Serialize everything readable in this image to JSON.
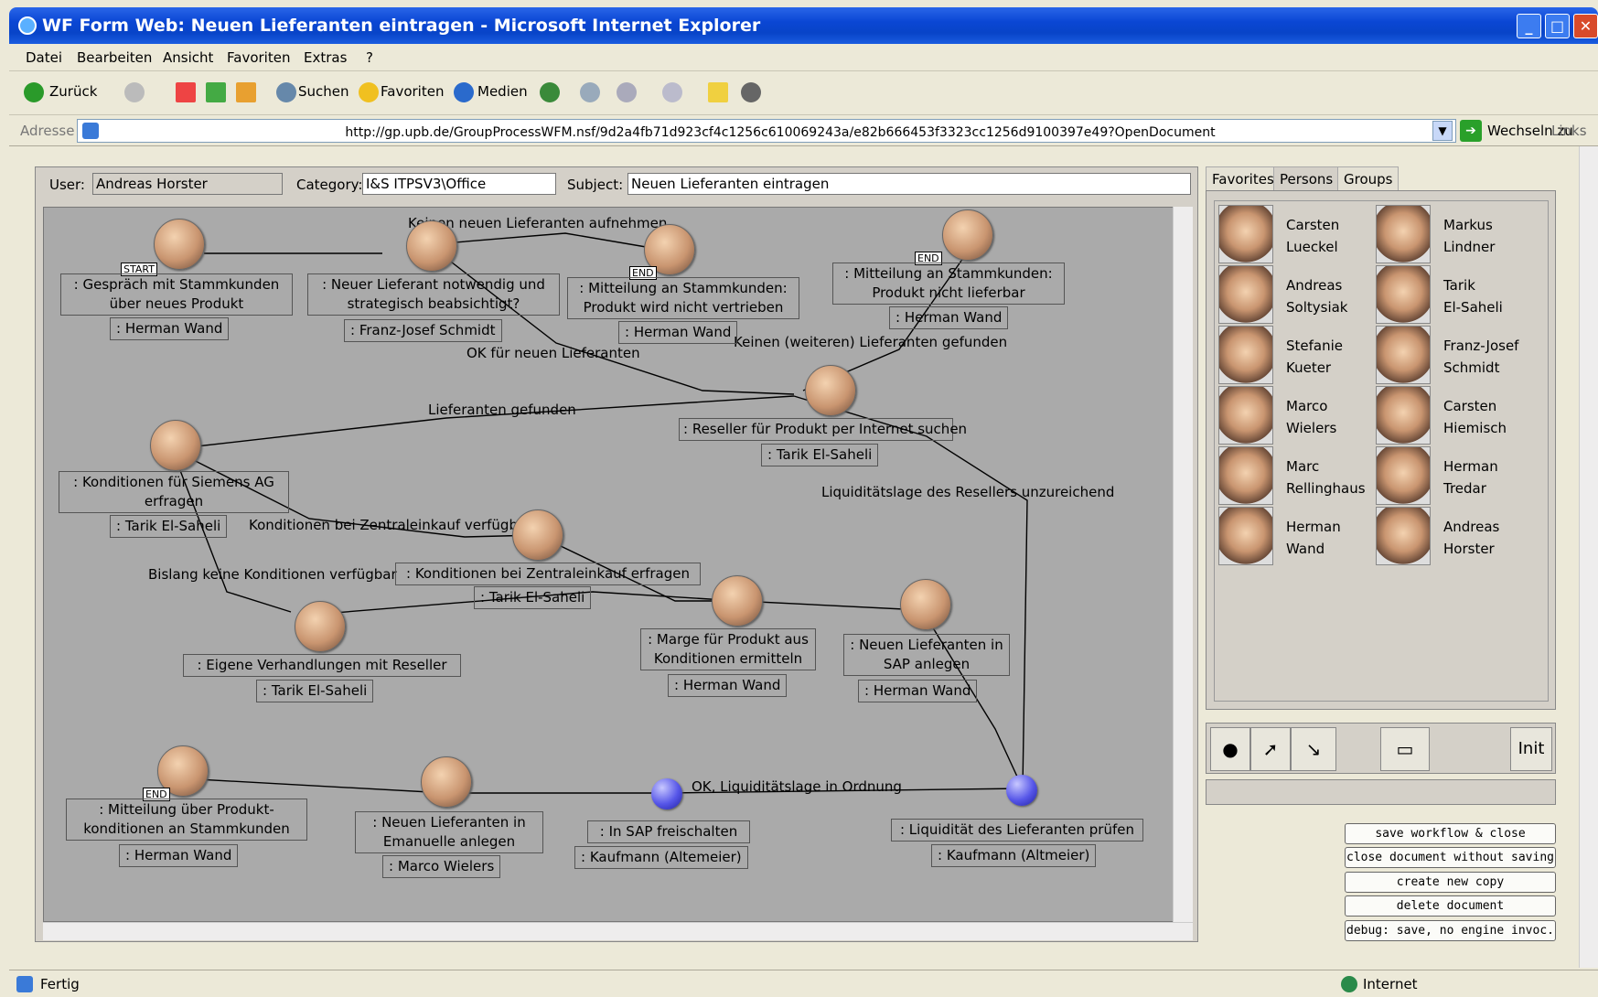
{
  "window": {
    "title": "WF Form Web: Neuen Lieferanten eintragen - Microsoft Internet Explorer"
  },
  "menu": [
    "Datei",
    "Bearbeiten",
    "Ansicht",
    "Favoriten",
    "Extras",
    "?"
  ],
  "toolbar": {
    "back": "Zurück",
    "search": "Suchen",
    "favorites": "Favoriten",
    "media": "Medien"
  },
  "address": {
    "label": "Adresse",
    "url": "http://gp.upb.de/GroupProcessWFM.nsf/9d2a4fb71d923cf4c1256c610069243a/e82b666453f3323cc1256d9100397e49?OpenDocument",
    "go": "Wechseln zu",
    "links": "Links"
  },
  "form": {
    "user_label": "User:",
    "user_value": "Andreas Horster",
    "category_label": "Category:",
    "category_value": "I&S ITPSV3\\Office",
    "subject_label": "Subject:",
    "subject_value": "Neuen Lieferanten eintragen"
  },
  "diagram": {
    "tags": {
      "start": "START",
      "end": "END"
    },
    "edge_labels": [
      "Keinen neuen Lieferanten aufnehmen",
      "OK für neuen Lieferanten",
      "Keinen (weiteren) Lieferanten gefunden",
      "Lieferanten gefunden",
      "Liquiditätslage des Resellers unzureichend",
      "Konditionen bei Zentraleinkauf verfügbar",
      "Bislang keine Konditionen verfügbar",
      "OK, Liquiditätslage in Ordnung"
    ],
    "tasks": [
      ": Gespräch mit Stammkunden über neues Produkt",
      ": Neuer Lieferant notwendig und strategisch beabsichtigt?",
      ": Mitteilung an Stammkunden: Produkt wird nicht vertrieben",
      ": Mitteilung an Stammkunden: Produkt nicht lieferbar",
      ": Reseller für Produkt per Internet suchen",
      ": Konditionen für Siemens AG erfragen",
      ": Konditionen bei Zentraleinkauf erfragen",
      ": Eigene Verhandlungen mit Reseller",
      ": Marge für Produkt aus Konditionen ermitteln",
      ": Neuen Lieferanten in SAP anlegen",
      ": Mitteilung über Produkt-konditionen an Stammkunden",
      ": Neuen Lieferanten in Emanuelle anlegen",
      ": In SAP freischalten",
      ": Liquidität des Lieferanten prüfen"
    ],
    "roles": [
      ": Herman Wand",
      ": Franz-Josef Schmidt",
      ": Herman Wand",
      ": Herman Wand",
      ": Tarik El-Saheli",
      ": Tarik El-Saheli",
      ": Tarik El-Saheli",
      ": Tarik El-Saheli",
      ": Herman Wand",
      ": Herman Wand",
      ": Herman Wand",
      ": Marco Wielers",
      ": Kaufmann (Altemeier)",
      ": Kaufmann (Altmeier)"
    ]
  },
  "panel": {
    "tabs": [
      "Favorites",
      "Persons",
      "Groups"
    ],
    "persons": [
      {
        "first": "Carsten",
        "last": "Lueckel"
      },
      {
        "first": "Markus",
        "last": "Lindner"
      },
      {
        "first": "Andreas",
        "last": "Soltysiak"
      },
      {
        "first": "Tarik",
        "last": "El-Saheli"
      },
      {
        "first": "Stefanie",
        "last": "Kueter"
      },
      {
        "first": "Franz-Josef",
        "last": "Schmidt"
      },
      {
        "first": "Marco",
        "last": "Wielers"
      },
      {
        "first": "Carsten",
        "last": "Hiemisch"
      },
      {
        "first": "Marc",
        "last": "Rellinghaus"
      },
      {
        "first": "Herman",
        "last": "Tredar"
      },
      {
        "first": "Herman",
        "last": "Wand"
      },
      {
        "first": "Andreas",
        "last": "Horster"
      }
    ],
    "init": "Init"
  },
  "actions": [
    "save workflow & close document",
    "close document without saving",
    "create new copy",
    "delete document",
    "debug: save, no engine invoc."
  ],
  "status": {
    "left": "Fertig",
    "zone": "Internet"
  }
}
